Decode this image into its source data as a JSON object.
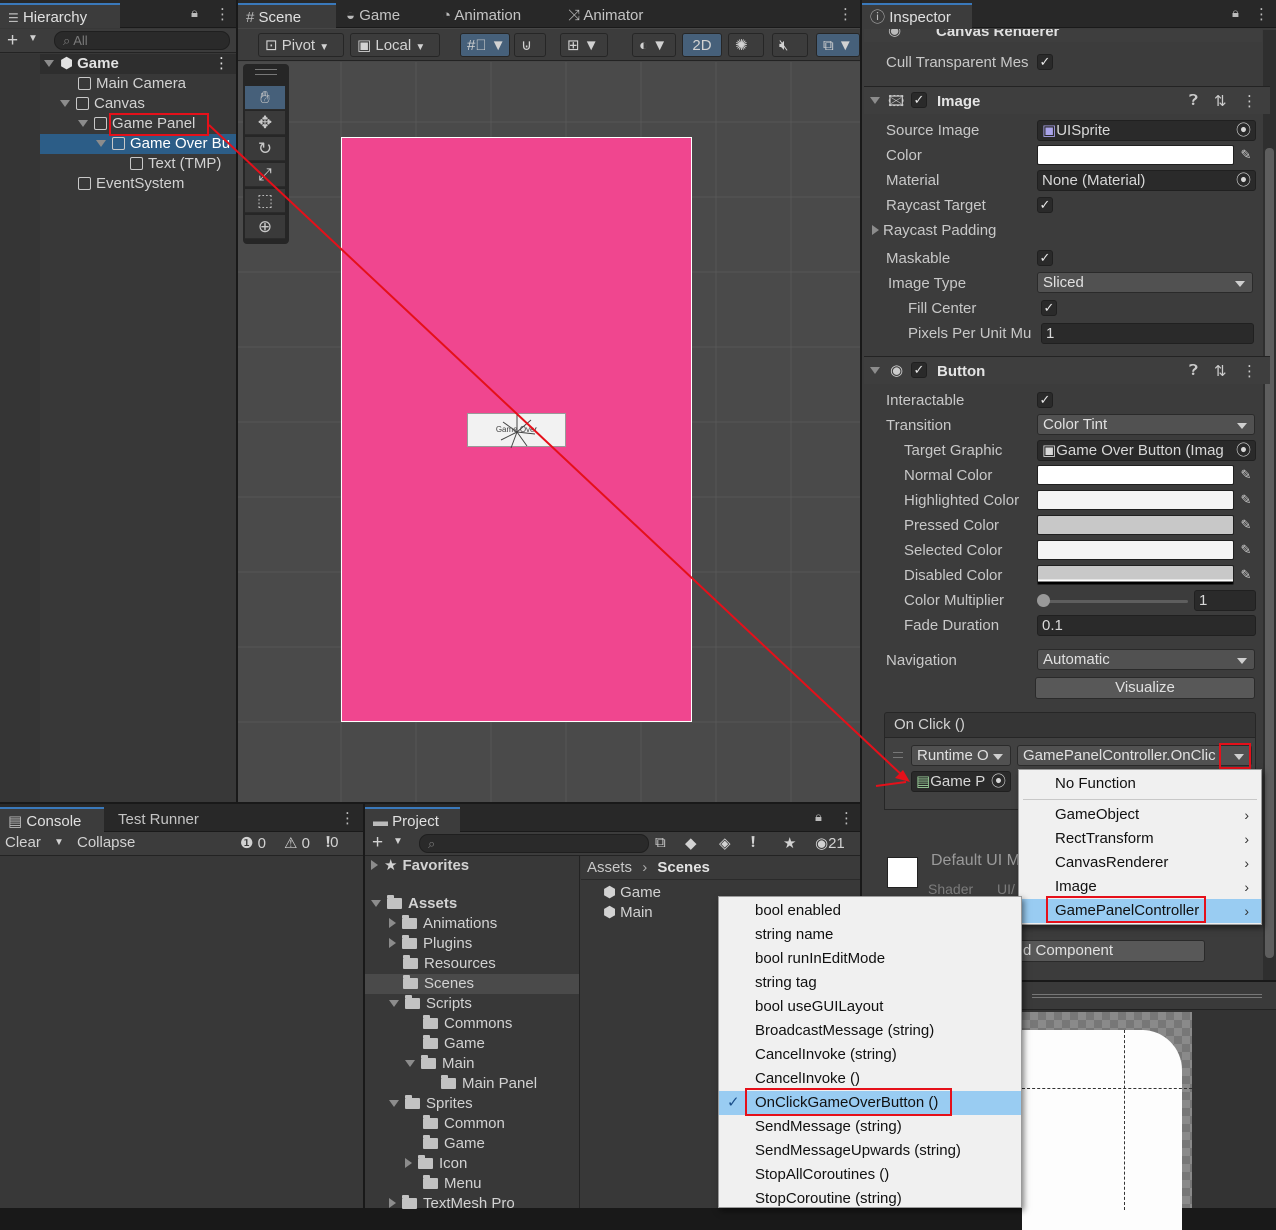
{
  "hierarchy": {
    "tab_label": "Hierarchy",
    "search_placeholder": "All",
    "scene_name": "Game",
    "items": [
      {
        "label": "Main Camera"
      },
      {
        "label": "Canvas"
      },
      {
        "label": "Game Panel"
      },
      {
        "label": "Game Over Bu"
      },
      {
        "label": "Text (TMP)"
      },
      {
        "label": "EventSystem"
      }
    ]
  },
  "scene_view": {
    "tabs": [
      "Scene",
      "Game",
      "Animation",
      "Animator"
    ],
    "pivot_label": "Pivot",
    "local_label": "Local",
    "mode_2d": "2D",
    "button_text": "Game Over"
  },
  "inspector": {
    "tab_label": "Inspector",
    "canvas_renderer": {
      "title": "Canvas Renderer",
      "cull_label": "Cull Transparent Mes"
    },
    "image": {
      "title": "Image",
      "source_image_label": "Source Image",
      "source_image_value": "UISprite",
      "color_label": "Color",
      "material_label": "Material",
      "material_value": "None (Material)",
      "raycast_target_label": "Raycast Target",
      "raycast_padding_label": "Raycast Padding",
      "maskable_label": "Maskable",
      "image_type_label": "Image Type",
      "image_type_value": "Sliced",
      "fill_center_label": "Fill Center",
      "ppu_label": "Pixels Per Unit Mu",
      "ppu_value": "1"
    },
    "button": {
      "title": "Button",
      "interactable_label": "Interactable",
      "transition_label": "Transition",
      "transition_value": "Color Tint",
      "target_graphic_label": "Target Graphic",
      "target_graphic_value": "Game Over Button (Imag",
      "normal_color_label": "Normal Color",
      "highlighted_color_label": "Highlighted Color",
      "pressed_color_label": "Pressed Color",
      "selected_color_label": "Selected Color",
      "disabled_color_label": "Disabled Color",
      "color_multiplier_label": "Color Multiplier",
      "color_multiplier_value": "1",
      "fade_duration_label": "Fade Duration",
      "fade_duration_value": "0.1",
      "navigation_label": "Navigation",
      "navigation_value": "Automatic",
      "visualize_label": "Visualize",
      "onclick_label": "On Click ()",
      "runtime_value": "Runtime O",
      "function_value": "GamePanelController.OnClic",
      "object_value": "Game P"
    },
    "material_preview": {
      "name": "Default UI M",
      "shader_label": "Shader",
      "shader_value": "UI/"
    },
    "add_component": "d Component"
  },
  "function_menu": {
    "items": [
      "No Function",
      "GameObject",
      "RectTransform",
      "CanvasRenderer",
      "Image",
      "GamePanelController"
    ]
  },
  "method_menu": {
    "items": [
      "bool enabled",
      "string name",
      "bool runInEditMode",
      "string tag",
      "bool useGUILayout",
      "BroadcastMessage (string)",
      "CancelInvoke (string)",
      "CancelInvoke ()",
      "OnClickGameOverButton ()",
      "SendMessage (string)",
      "SendMessageUpwards (string)",
      "StopAllCoroutines ()",
      "StopCoroutine (string)"
    ]
  },
  "console": {
    "tabs": [
      "Console",
      "Test Runner"
    ],
    "clear_label": "Clear",
    "collapse_label": "Collapse",
    "log_count": "0",
    "warn_count": "0",
    "error_count": "0"
  },
  "project": {
    "tab_label": "Project",
    "asset_count": "21",
    "favorites_label": "Favorites",
    "assets_label": "Assets",
    "tree": [
      "Animations",
      "Plugins",
      "Resources",
      "Scenes",
      "Scripts",
      "Commons",
      "Game",
      "Main",
      "Main Panel",
      "Sprites",
      "Common",
      "Game",
      "Icon",
      "Menu",
      "TextMesh Pro"
    ],
    "breadcrumb_root": "Assets",
    "breadcrumb_current": "Scenes",
    "files": [
      "Game",
      "Main"
    ]
  },
  "colors": {
    "panel_pink": "#f0468f",
    "selection_blue": "#2c5d87",
    "highlight_red": "#e5101a",
    "menu_highlight": "#99ccf2"
  }
}
